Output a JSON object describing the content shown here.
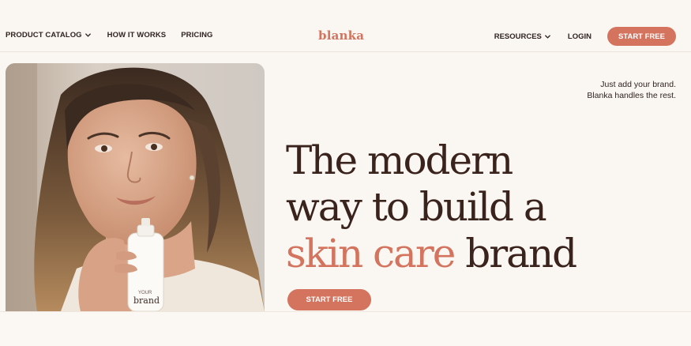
{
  "header": {
    "nav_left": [
      {
        "label": "PRODUCT CATALOG",
        "has_dropdown": true
      },
      {
        "label": "HOW IT WORKS",
        "has_dropdown": false
      },
      {
        "label": "PRICING",
        "has_dropdown": false
      }
    ],
    "logo": "blanka",
    "nav_right": {
      "resources": "RESOURCES",
      "login": "LOGIN",
      "cta": "START FREE"
    }
  },
  "hero": {
    "tagline_line1": "Just add your brand.",
    "tagline_line2": "Blanka handles the rest.",
    "headline_line1": "The modern",
    "headline_line2": "way to build a",
    "headline_accent": "skin care",
    "headline_end": "brand",
    "cta": "START FREE",
    "bottle_label_line1": "YOUR",
    "bottle_label_line2": "brand"
  },
  "colors": {
    "accent": "#d4735e",
    "background": "#faf6f1",
    "heading": "#3a231d"
  },
  "icons": [
    "chevron-down-icon"
  ]
}
